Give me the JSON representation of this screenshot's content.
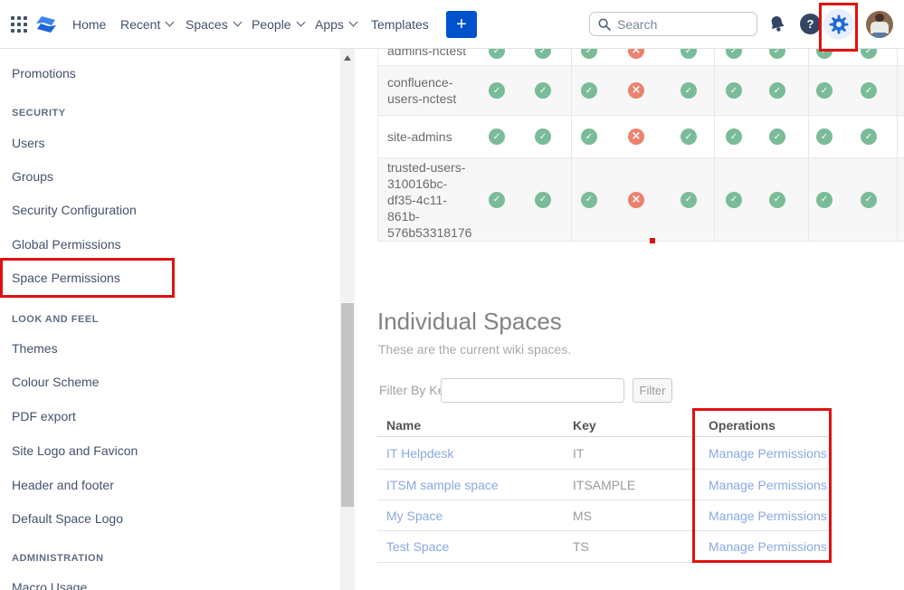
{
  "nav": {
    "items": [
      {
        "label": "Home",
        "chevron": false
      },
      {
        "label": "Recent",
        "chevron": true
      },
      {
        "label": "Spaces",
        "chevron": true
      },
      {
        "label": "People",
        "chevron": true
      },
      {
        "label": "Apps",
        "chevron": true
      },
      {
        "label": "Templates",
        "chevron": false
      }
    ],
    "plus_label": "+",
    "search_placeholder": "Search"
  },
  "sidebar": {
    "sections": [
      {
        "header": "",
        "items": [
          "Promotions"
        ]
      },
      {
        "header": "SECURITY",
        "items": [
          "Users",
          "Groups",
          "Security Configuration",
          "Global Permissions",
          "Space Permissions"
        ]
      },
      {
        "header": "LOOK AND FEEL",
        "items": [
          "Themes",
          "Colour Scheme",
          "PDF export",
          "Site Logo and Favicon",
          "Header and footer",
          "Default Space Logo"
        ]
      },
      {
        "header": "ADMINISTRATION",
        "items": [
          "Macro Usage"
        ]
      }
    ],
    "selected_item": "Space Permissions"
  },
  "matrix": {
    "rows": [
      {
        "name": "admins-nctest",
        "cells": [
          [
            "granted",
            "granted"
          ],
          [
            "granted",
            "denied",
            "granted"
          ],
          [
            "granted",
            "granted"
          ],
          [
            "granted",
            "granted"
          ]
        ]
      },
      {
        "name": "confluence-users-nctest",
        "cells": [
          [
            "granted",
            "granted"
          ],
          [
            "granted",
            "denied",
            "granted"
          ],
          [
            "granted",
            "granted"
          ],
          [
            "granted",
            "granted"
          ]
        ]
      },
      {
        "name": "site-admins",
        "cells": [
          [
            "granted",
            "granted"
          ],
          [
            "granted",
            "denied",
            "granted"
          ],
          [
            "granted",
            "granted"
          ],
          [
            "granted",
            "granted"
          ]
        ]
      },
      {
        "name": "trusted-users-310016bc-df35-4c11-861b-576b53318176",
        "cells": [
          [
            "granted",
            "granted"
          ],
          [
            "granted",
            "denied",
            "granted"
          ],
          [
            "granted",
            "granted"
          ],
          [
            "granted",
            "granted"
          ]
        ]
      }
    ]
  },
  "spaces": {
    "title": "Individual Spaces",
    "subtitle": "These are the current wiki spaces.",
    "filter_label": "Filter By Key:",
    "filter_value": "",
    "filter_button": "Filter",
    "columns": [
      "Name",
      "Key",
      "Operations"
    ],
    "rows": [
      {
        "name": "IT Helpdesk",
        "key": "IT",
        "operation": "Manage Permissions"
      },
      {
        "name": "ITSM sample space",
        "key": "ITSAMPLE",
        "operation": "Manage Permissions"
      },
      {
        "name": "My Space",
        "key": "MS",
        "operation": "Manage Permissions"
      },
      {
        "name": "Test Space",
        "key": "TS",
        "operation": "Manage Permissions"
      }
    ]
  },
  "icons": {
    "granted": "check-circle",
    "denied": "cross-circle",
    "nav": [
      "app-grid-icon",
      "confluence-logo",
      "plus-icon",
      "search-icon",
      "bell-icon",
      "help-icon",
      "gear-icon",
      "avatar"
    ]
  },
  "annotations": {
    "boxes": [
      "gear-icon",
      "sidebar-space-permissions",
      "operations-column"
    ],
    "color": "#e01010"
  },
  "colors": {
    "accent_blue": "#0052CC",
    "nav_text": "#42526e",
    "link_blue": "#89a9e3",
    "granted_green": "#7abc98",
    "denied_red": "#ec826d",
    "annotation_red": "#e01010"
  }
}
